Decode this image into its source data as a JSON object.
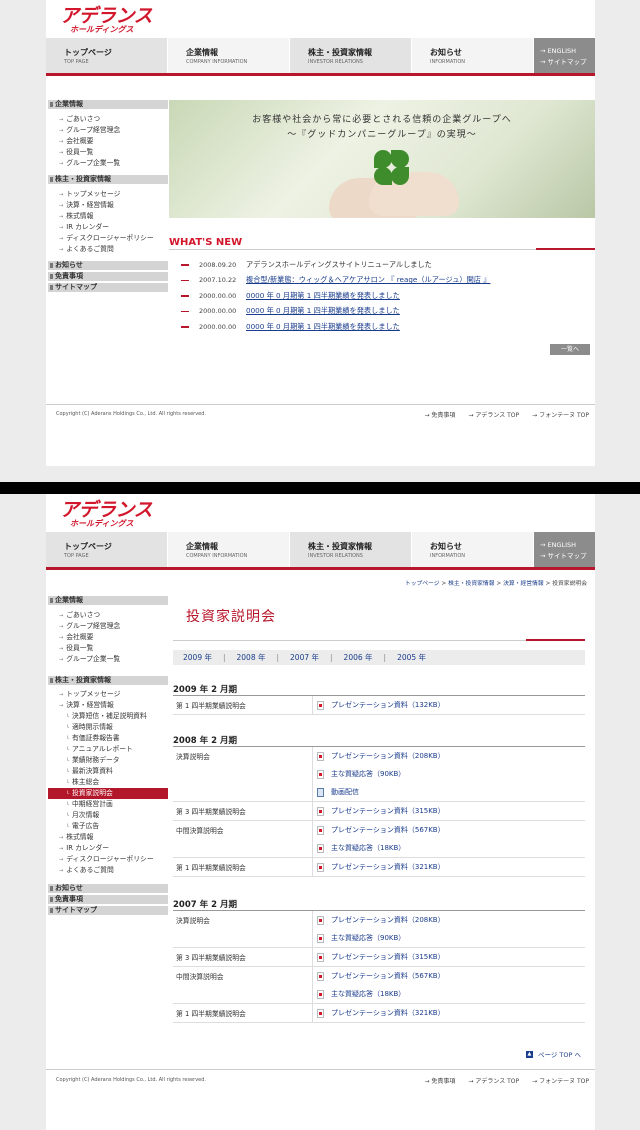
{
  "logo": {
    "main": "アデランス",
    "sub": "ホールディングス"
  },
  "nav": {
    "items": [
      {
        "jp": "トップページ",
        "en": "TOP PAGE"
      },
      {
        "jp": "企業情報",
        "en": "COMPANY INFORMATION"
      },
      {
        "jp": "株主・投資家情報",
        "en": "INVESTOR RELATIONS"
      },
      {
        "jp": "お知らせ",
        "en": "INFORMATION"
      }
    ],
    "english": "ENGLISH",
    "sitemap": "サイトマップ"
  },
  "page1": {
    "sidebar": {
      "company_head": "企業情報",
      "company_items": [
        "ごあいさつ",
        "グループ経営理念",
        "会社概要",
        "役員一覧",
        "グループ企業一覧"
      ],
      "ir_head": "株主・投資家情報",
      "ir_items": [
        "トップメッセージ",
        "決算・経営情報",
        "株式情報",
        "IR カレンダー",
        "ディスクロージャーポリシー",
        "よくあるご質問"
      ],
      "bottom_items": [
        "お知らせ",
        "免責事項",
        "サイトマップ"
      ]
    },
    "hero": {
      "line1": "お客様や社会から常に必要とされる信頼の企業グループへ",
      "line2": "～『グッドカンパニーグループ』の実現～"
    },
    "whats_new": {
      "title": "WHAT'S NEW",
      "items": [
        {
          "date": "2008.09.20",
          "text": "アデランスホールディングスサイトリニューアルしました"
        },
        {
          "date": "2007.10.22",
          "text": "複合型/新業態：ウィッグ＆ヘアケアサロン 『 reage（ルアージュ）開店 』"
        },
        {
          "date": "2000.00.00",
          "text": "0000 年 0 月期第 1 四半期業績を発表しました"
        },
        {
          "date": "2000.00.00",
          "text": "0000 年 0 月期第 1 四半期業績を発表しました"
        },
        {
          "date": "2000.00.00",
          "text": "0000 年 0 月期第 1 四半期業績を発表しました"
        }
      ],
      "list_button": "一覧へ"
    }
  },
  "footer": {
    "copyright": "Copyright (C) Aderans Holdings Co., Ltd. All rights reserved.",
    "links": [
      "免責事項",
      "アデランス TOP",
      "フォンテーヌ TOP"
    ]
  },
  "page2": {
    "breadcrumb": [
      "トップページ",
      "株主・投資家情報",
      "決算・経営情報",
      "投資家説明会"
    ],
    "title": "投資家説明会",
    "years": [
      "2009 年",
      "2008 年",
      "2007 年",
      "2006 年",
      "2005 年"
    ],
    "sidebar": {
      "company_head": "企業情報",
      "company_items": [
        "ごあいさつ",
        "グループ経営理念",
        "会社概要",
        "役員一覧",
        "グループ企業一覧"
      ],
      "ir_head": "株主・投資家情報",
      "ir_items_top": [
        "トップメッセージ",
        "決算・経営情報"
      ],
      "ir_sub": [
        "決算短信・補足説明資料",
        "適時開示情報",
        "有価証券報告書",
        "アニュアルレポート",
        "業績財務データ",
        "最新決算資料",
        "株主総会",
        "投資家説明会",
        "中期経営計画",
        "月次情報",
        "電子広告"
      ],
      "ir_items_bottom": [
        "株式情報",
        "IR カレンダー",
        "ディスクロージャーポリシー",
        "よくあるご質問"
      ],
      "bottom_items": [
        "お知らせ",
        "免責事項",
        "サイトマップ"
      ]
    },
    "sections": [
      {
        "title": "2009 年 2 月期",
        "rows": [
          {
            "label": "第 1 四半期業績説明会",
            "links": [
              {
                "icon": "pdf",
                "text": "プレゼンテーション資料（132KB）"
              }
            ]
          }
        ]
      },
      {
        "title": "2008 年 2 月期",
        "rows": [
          {
            "label": "決算説明会",
            "links": [
              {
                "icon": "pdf",
                "text": "プレゼンテーション資料（208KB）"
              },
              {
                "icon": "pdf",
                "text": "主な質疑応答（90KB）"
              },
              {
                "icon": "movie",
                "text": "動画配信"
              }
            ]
          },
          {
            "label": "第 3 四半期業績説明会",
            "links": [
              {
                "icon": "pdf",
                "text": "プレゼンテーション資料（315KB）"
              }
            ]
          },
          {
            "label": "中間決算説明会",
            "links": [
              {
                "icon": "pdf",
                "text": "プレゼンテーション資料（567KB）"
              },
              {
                "icon": "pdf",
                "text": "主な質疑応答（18KB）"
              }
            ]
          },
          {
            "label": "第 1 四半期業績説明会",
            "links": [
              {
                "icon": "pdf",
                "text": "プレゼンテーション資料（321KB）"
              }
            ]
          }
        ]
      },
      {
        "title": "2007 年 2 月期",
        "rows": [
          {
            "label": "決算説明会",
            "links": [
              {
                "icon": "pdf",
                "text": "プレゼンテーション資料（208KB）"
              },
              {
                "icon": "pdf",
                "text": "主な質疑応答（90KB）"
              }
            ]
          },
          {
            "label": "第 3 四半期業績説明会",
            "links": [
              {
                "icon": "pdf",
                "text": "プレゼンテーション資料（315KB）"
              }
            ]
          },
          {
            "label": "中間決算説明会",
            "links": [
              {
                "icon": "pdf",
                "text": "プレゼンテーション資料（567KB）"
              },
              {
                "icon": "pdf",
                "text": "主な質疑応答（18KB）"
              }
            ]
          },
          {
            "label": "第 1 四半期業績説明会",
            "links": [
              {
                "icon": "pdf",
                "text": "プレゼンテーション資料（321KB）"
              }
            ]
          }
        ]
      }
    ],
    "page_top": "ページ TOP へ"
  }
}
